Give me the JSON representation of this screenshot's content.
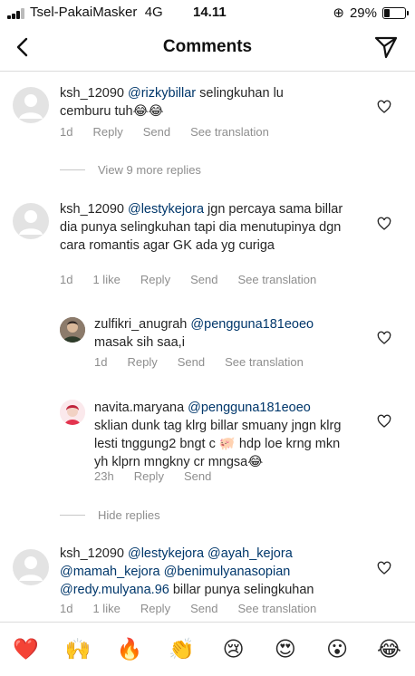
{
  "status": {
    "carrier": "Tsel-PakaiMasker",
    "network": "4G",
    "time": "14.11",
    "battery": "29%",
    "battery_level": 0.29
  },
  "header": {
    "title": "Comments"
  },
  "comments": [
    {
      "user": "ksh_12090",
      "mention": "@rizkybillar",
      "text": " selingkuhan lu cemburu tuh😂😂",
      "time": "1d",
      "reply": "Reply",
      "send": "Send",
      "translate": "See translation"
    },
    {
      "user": "ksh_12090",
      "mention": "@lestykejora",
      "text": " jgn percaya sama billar dia punya selingkuhan tapi dia menutupinya dgn cara romantis agar GK ada yg curiga",
      "time": "1d",
      "likes": "1 like",
      "reply": "Reply",
      "send": "Send",
      "translate": "See translation"
    },
    {
      "user": "ksh_12090",
      "mentions": [
        "@lestykejora",
        "@ayah_kejora",
        "@mamah_kejora",
        "@benimulyanasopian",
        "@redy.mulyana.96"
      ],
      "text": " billar punya selingkuhan",
      "time": "1d",
      "likes": "1 like",
      "reply": "Reply",
      "send": "Send",
      "translate": "See translation"
    }
  ],
  "replies": [
    {
      "user": "zulfikri_anugrah",
      "mention": "@pengguna181eoeo",
      "text": "masak sih saa,i",
      "time": "1d",
      "reply": "Reply",
      "send": "Send",
      "translate": "See translation"
    },
    {
      "user": "navita.maryana",
      "mention": "@pengguna181eoeo",
      "text": "sklian dunk tag klrg billar smuany jngn klrg lesti tnggung2 bngt c 🐖 hdp loe krng mkn yh klprn mngkny cr mngsa😂",
      "time": "23h",
      "reply": "Reply",
      "send": "Send"
    }
  ],
  "toggles": {
    "view_more": "View 9 more replies",
    "hide": "Hide replies"
  },
  "emoji_bar": [
    "❤️",
    "🙌",
    "🔥",
    "👏",
    "😢",
    "😍",
    "😮",
    "😂"
  ],
  "icons": {
    "back": "chevron-left-icon",
    "share": "paper-plane-icon",
    "like": "heart-outline-icon"
  }
}
